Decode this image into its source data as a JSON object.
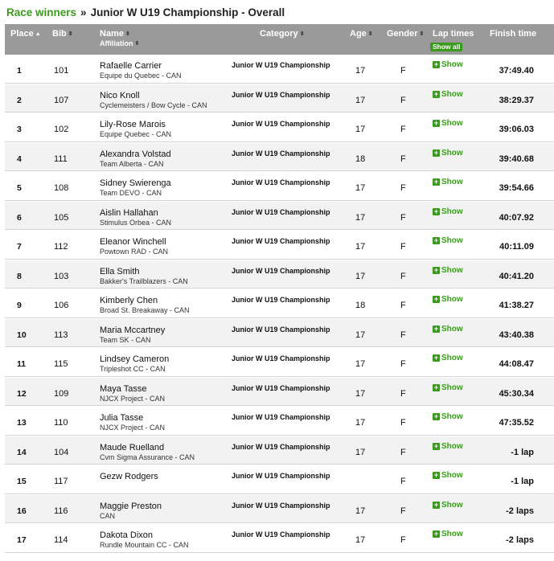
{
  "breadcrumb": {
    "link": "Race winners",
    "separator": "»",
    "title": "Junior W U19 Championship - Overall"
  },
  "columns": {
    "place": "Place",
    "bib": "Bib",
    "name": "Name",
    "affiliation": "Affiliation",
    "category": "Category",
    "age": "Age",
    "gender": "Gender",
    "lap_times": "Lap times",
    "show_all": "Show all",
    "finish_time": "Finish time",
    "sort_asc_glyph": "▲",
    "sort_glyph": "⬍"
  },
  "lap_show_label": "Show",
  "rows": [
    {
      "place": "1",
      "bib": "101",
      "name": "Rafaelle Carrier",
      "affiliation": "Equipe du Quebec - CAN",
      "category": "Junior W U19 Championship",
      "age": "17",
      "gender": "F",
      "finish": "37:49.40"
    },
    {
      "place": "2",
      "bib": "107",
      "name": "Nico Knoll",
      "affiliation": "Cyclemeisters / Bow Cycle - CAN",
      "category": "Junior W U19 Championship",
      "age": "17",
      "gender": "F",
      "finish": "38:29.37"
    },
    {
      "place": "3",
      "bib": "102",
      "name": "Lily-Rose Marois",
      "affiliation": "Equipe Quebec - CAN",
      "category": "Junior W U19 Championship",
      "age": "17",
      "gender": "F",
      "finish": "39:06.03"
    },
    {
      "place": "4",
      "bib": "111",
      "name": "Alexandra Volstad",
      "affiliation": "Team Alberta - CAN",
      "category": "Junior W U19 Championship",
      "age": "18",
      "gender": "F",
      "finish": "39:40.68"
    },
    {
      "place": "5",
      "bib": "108",
      "name": "Sidney Swierenga",
      "affiliation": "Team DEVO - CAN",
      "category": "Junior W U19 Championship",
      "age": "17",
      "gender": "F",
      "finish": "39:54.66"
    },
    {
      "place": "6",
      "bib": "105",
      "name": "Aislin Hallahan",
      "affiliation": "Stimulus Orbea - CAN",
      "category": "Junior W U19 Championship",
      "age": "17",
      "gender": "F",
      "finish": "40:07.92"
    },
    {
      "place": "7",
      "bib": "112",
      "name": "Eleanor Winchell",
      "affiliation": "Powtown RAD - CAN",
      "category": "Junior W U19 Championship",
      "age": "17",
      "gender": "F",
      "finish": "40:11.09"
    },
    {
      "place": "8",
      "bib": "103",
      "name": "Ella Smith",
      "affiliation": "Bakker's Trailblazers - CAN",
      "category": "Junior W U19 Championship",
      "age": "17",
      "gender": "F",
      "finish": "40:41.20"
    },
    {
      "place": "9",
      "bib": "106",
      "name": "Kimberly Chen",
      "affiliation": "Broad St. Breakaway - CAN",
      "category": "Junior W U19 Championship",
      "age": "18",
      "gender": "F",
      "finish": "41:38.27"
    },
    {
      "place": "10",
      "bib": "113",
      "name": "Maria Mccartney",
      "affiliation": "Team SK - CAN",
      "category": "Junior W U19 Championship",
      "age": "17",
      "gender": "F",
      "finish": "43:40.38"
    },
    {
      "place": "11",
      "bib": "115",
      "name": "Lindsey Cameron",
      "affiliation": "Tripleshot CC - CAN",
      "category": "Junior W U19 Championship",
      "age": "17",
      "gender": "F",
      "finish": "44:08.47"
    },
    {
      "place": "12",
      "bib": "109",
      "name": "Maya Tasse",
      "affiliation": "NJCX Project - CAN",
      "category": "Junior W U19 Championship",
      "age": "17",
      "gender": "F",
      "finish": "45:30.34"
    },
    {
      "place": "13",
      "bib": "110",
      "name": "Julia Tasse",
      "affiliation": "NJCX Project - CAN",
      "category": "Junior W U19 Championship",
      "age": "17",
      "gender": "F",
      "finish": "47:35.52"
    },
    {
      "place": "14",
      "bib": "104",
      "name": "Maude Ruelland",
      "affiliation": "Cvm Sigma Assurance - CAN",
      "category": "Junior W U19 Championship",
      "age": "17",
      "gender": "F",
      "finish": "-1 lap"
    },
    {
      "place": "15",
      "bib": "117",
      "name": "Gezw Rodgers",
      "affiliation": "",
      "category": "Junior W U19 Championship",
      "age": "",
      "gender": "F",
      "finish": "-1 lap"
    },
    {
      "place": "16",
      "bib": "116",
      "name": "Maggie Preston",
      "affiliation": "CAN",
      "category": "Junior W U19 Championship",
      "age": "17",
      "gender": "F",
      "finish": "-2 laps"
    },
    {
      "place": "17",
      "bib": "114",
      "name": "Dakota Dixon",
      "affiliation": "Rundle Mountain CC - CAN",
      "category": "Junior W U19 Championship",
      "age": "17",
      "gender": "F",
      "finish": "-2 laps"
    }
  ],
  "colors": {
    "link_green": "#3d9a1e",
    "header_gray": "#9a9a9a",
    "row_alt": "#f2f2f2"
  }
}
